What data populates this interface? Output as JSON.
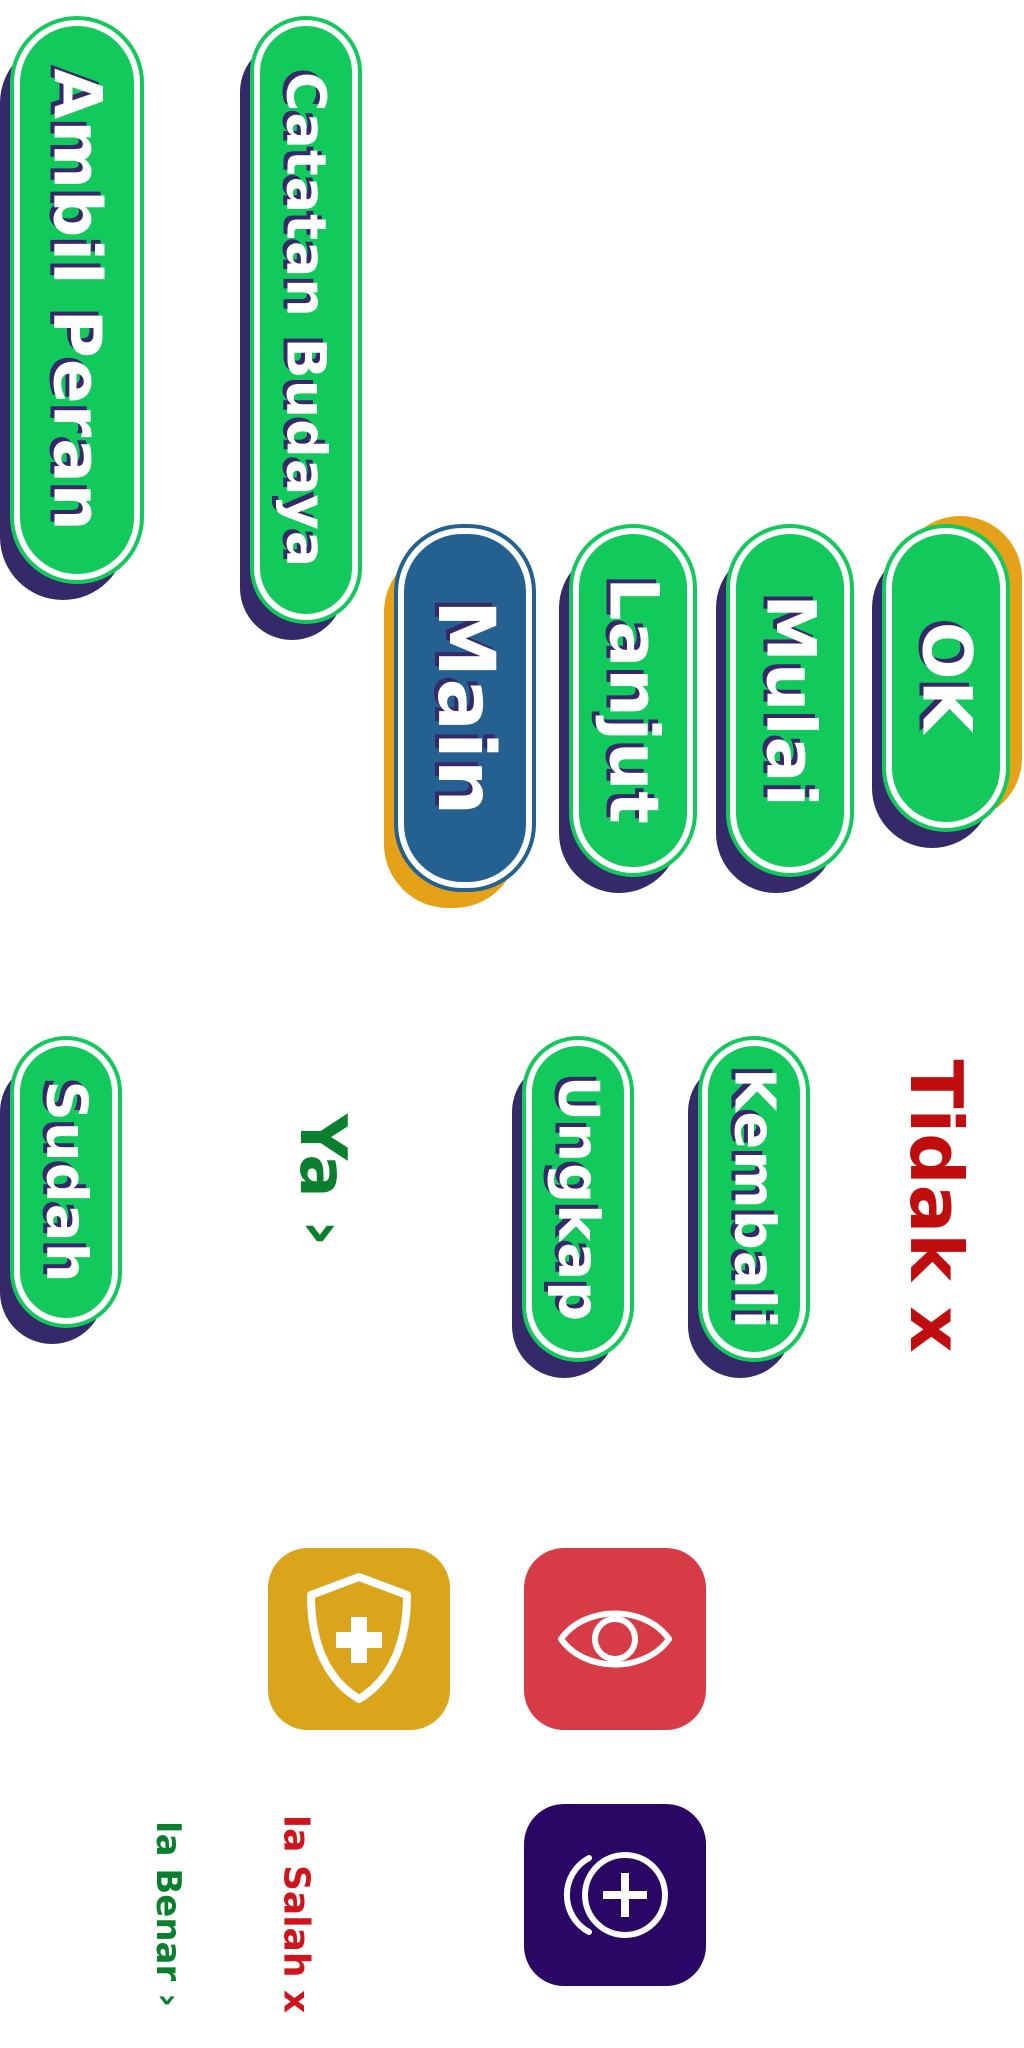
{
  "buttons": {
    "ambil_peran": "Ambil Peran",
    "catatan_budaya": "Catatan Budaya",
    "main": "Main",
    "lanjut": "Lanjut",
    "mulai": "Mulai",
    "ok": "OK",
    "sudah": "Sudah",
    "ungkap": "Ungkap",
    "kembali": "Kembali"
  },
  "text_links": {
    "ya": "Ya ›",
    "tidak": "Tidak x",
    "ia_salah": "Ia Salah x",
    "ia_benar": "Ia Benar ›"
  },
  "icons": {
    "shield": "shield-plus-icon",
    "eye": "eye-icon",
    "add_circle": "add-circle-icon"
  },
  "colors": {
    "green": "#12c95c",
    "blue": "#246090",
    "shadow": "#35296a",
    "gold": "#e5a118",
    "shield_tile": "#daa41b",
    "eye_tile": "#d73c46",
    "add_tile": "#2a0764",
    "red_text": "#c00d0d",
    "green_text": "#0a7f2e"
  }
}
